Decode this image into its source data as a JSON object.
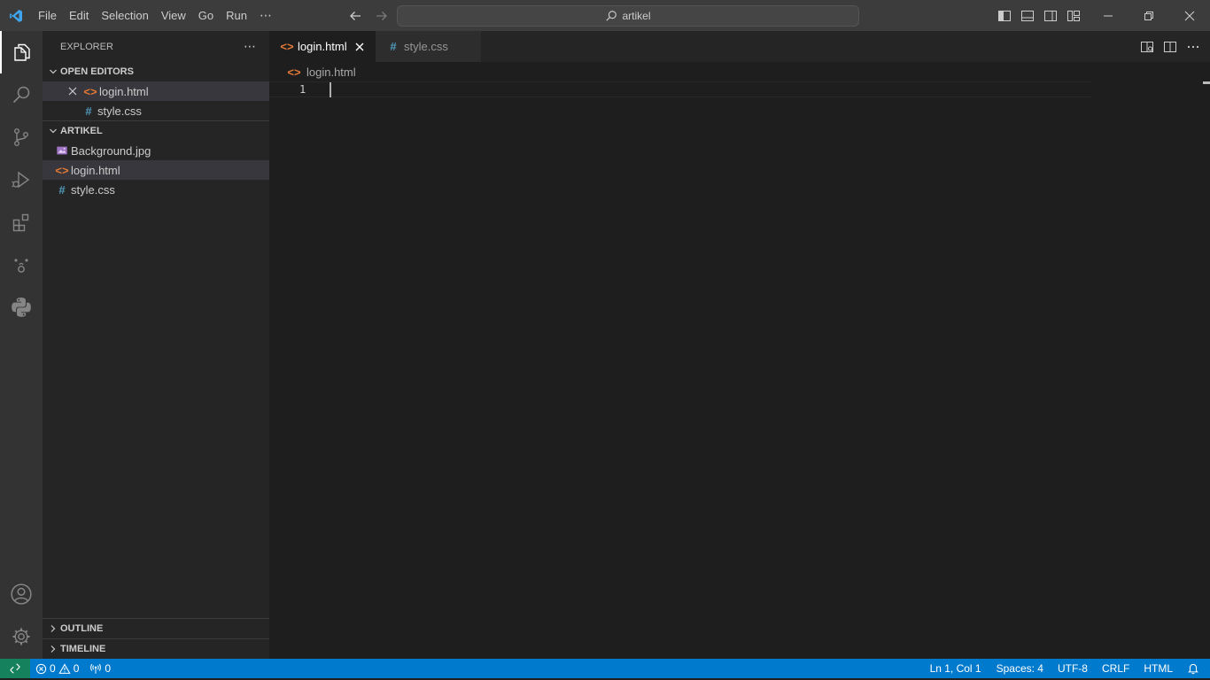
{
  "titlebar": {
    "menu": [
      "File",
      "Edit",
      "Selection",
      "View",
      "Go",
      "Run"
    ],
    "more": "⋯",
    "search_text": "artikel"
  },
  "sidebar": {
    "title": "EXPLORER",
    "more": "⋯",
    "open_editors": {
      "label": "OPEN EDITORS",
      "items": [
        {
          "name": "login.html",
          "icon": "<>",
          "type": "html"
        },
        {
          "name": "style.css",
          "icon": "#",
          "type": "css"
        }
      ]
    },
    "folder": {
      "label": "ARTIKEL",
      "items": [
        {
          "name": "Background.jpg",
          "type": "image"
        },
        {
          "name": "login.html",
          "icon": "<>",
          "type": "html"
        },
        {
          "name": "style.css",
          "icon": "#",
          "type": "css"
        }
      ]
    },
    "outline_label": "OUTLINE",
    "timeline_label": "TIMELINE"
  },
  "editor": {
    "tabs": [
      {
        "label": "login.html",
        "icon": "<>",
        "active": true
      },
      {
        "label": "style.css",
        "icon": "#",
        "active": false
      }
    ],
    "breadcrumb": "login.html",
    "breadcrumb_icon": "<>",
    "line_number": "1"
  },
  "statusbar": {
    "errors": "0",
    "warnings": "0",
    "ports": "0",
    "position": "Ln 1, Col 1",
    "spaces": "Spaces: 4",
    "encoding": "UTF-8",
    "eol": "CRLF",
    "language": "HTML"
  },
  "colors": {
    "accent": "#007acc",
    "remote": "#16825d",
    "html_icon": "#e37933",
    "css_icon": "#519aba"
  }
}
